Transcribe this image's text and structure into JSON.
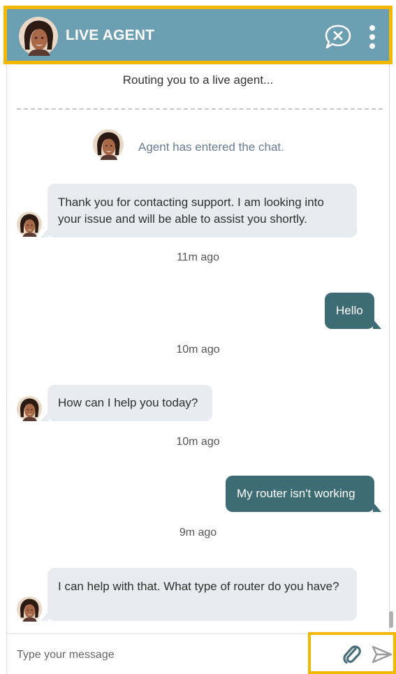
{
  "header": {
    "title": "LIVE AGENT",
    "icons": {
      "avatar": "agent-avatar",
      "end_chat": "end-chat-icon",
      "menu": "more-vertical-icon"
    }
  },
  "chat": {
    "routing_text": "Routing you to a live agent...",
    "agent_entered_text": "Agent has entered the chat.",
    "messages": [
      {
        "sender": "agent",
        "text": "Thank you for contacting support.  I am looking into your issue and will be able to assist you shortly.",
        "time": "11m ago"
      },
      {
        "sender": "user",
        "text": "Hello",
        "time": "10m ago"
      },
      {
        "sender": "agent",
        "text": "How can I help you today?",
        "time": "10m ago"
      },
      {
        "sender": "user",
        "text": "My router isn't working",
        "time": "9m ago"
      },
      {
        "sender": "agent",
        "text": "I can help with that. What type of router do you have?"
      }
    ]
  },
  "composer": {
    "placeholder": "Type your message",
    "value": "",
    "icons": {
      "attach": "paperclip-icon",
      "send": "send-icon"
    }
  },
  "colors": {
    "header_bg": "#6b9fb1",
    "highlight": "#f5b800",
    "agent_bubble": "#e8ebef",
    "user_bubble": "#3d6c74",
    "agent_entered_text": "#6a7c93"
  }
}
